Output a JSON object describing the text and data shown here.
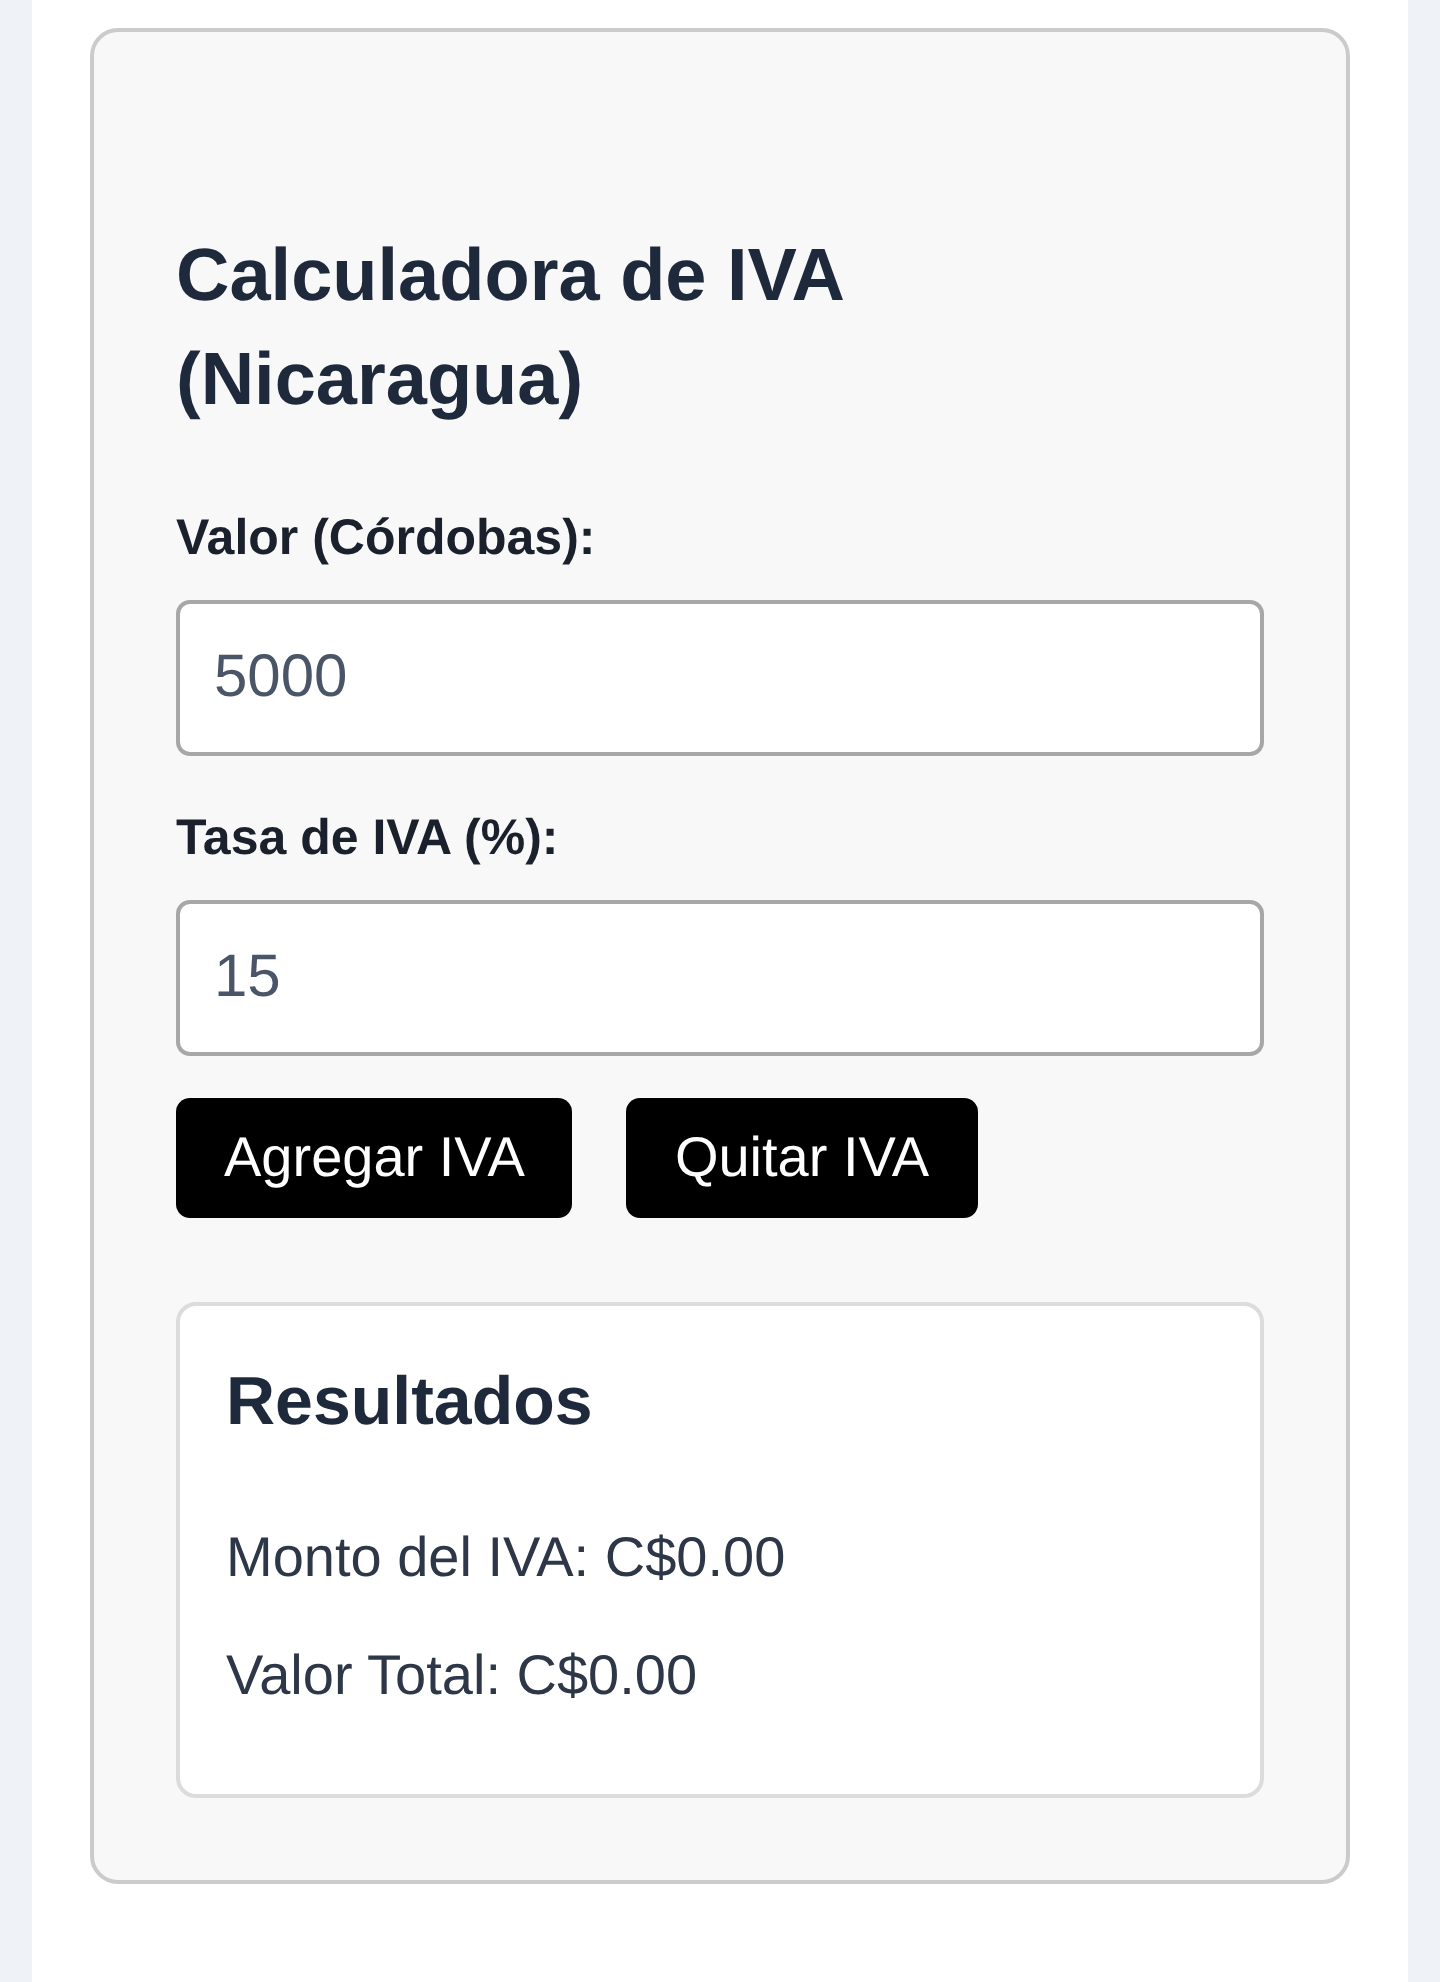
{
  "calculator": {
    "title": "Calculadora de IVA (Nicaragua)",
    "fields": [
      {
        "label": "Valor (Córdobas):",
        "value": "5000"
      },
      {
        "label": "Tasa de IVA (%):",
        "value": "15"
      }
    ],
    "buttons": [
      "Agregar IVA",
      "Quitar IVA"
    ],
    "results": {
      "title": "Resultados",
      "lines": [
        "Monto del IVA: C$0.00",
        "Valor Total: C$0.00"
      ]
    }
  }
}
